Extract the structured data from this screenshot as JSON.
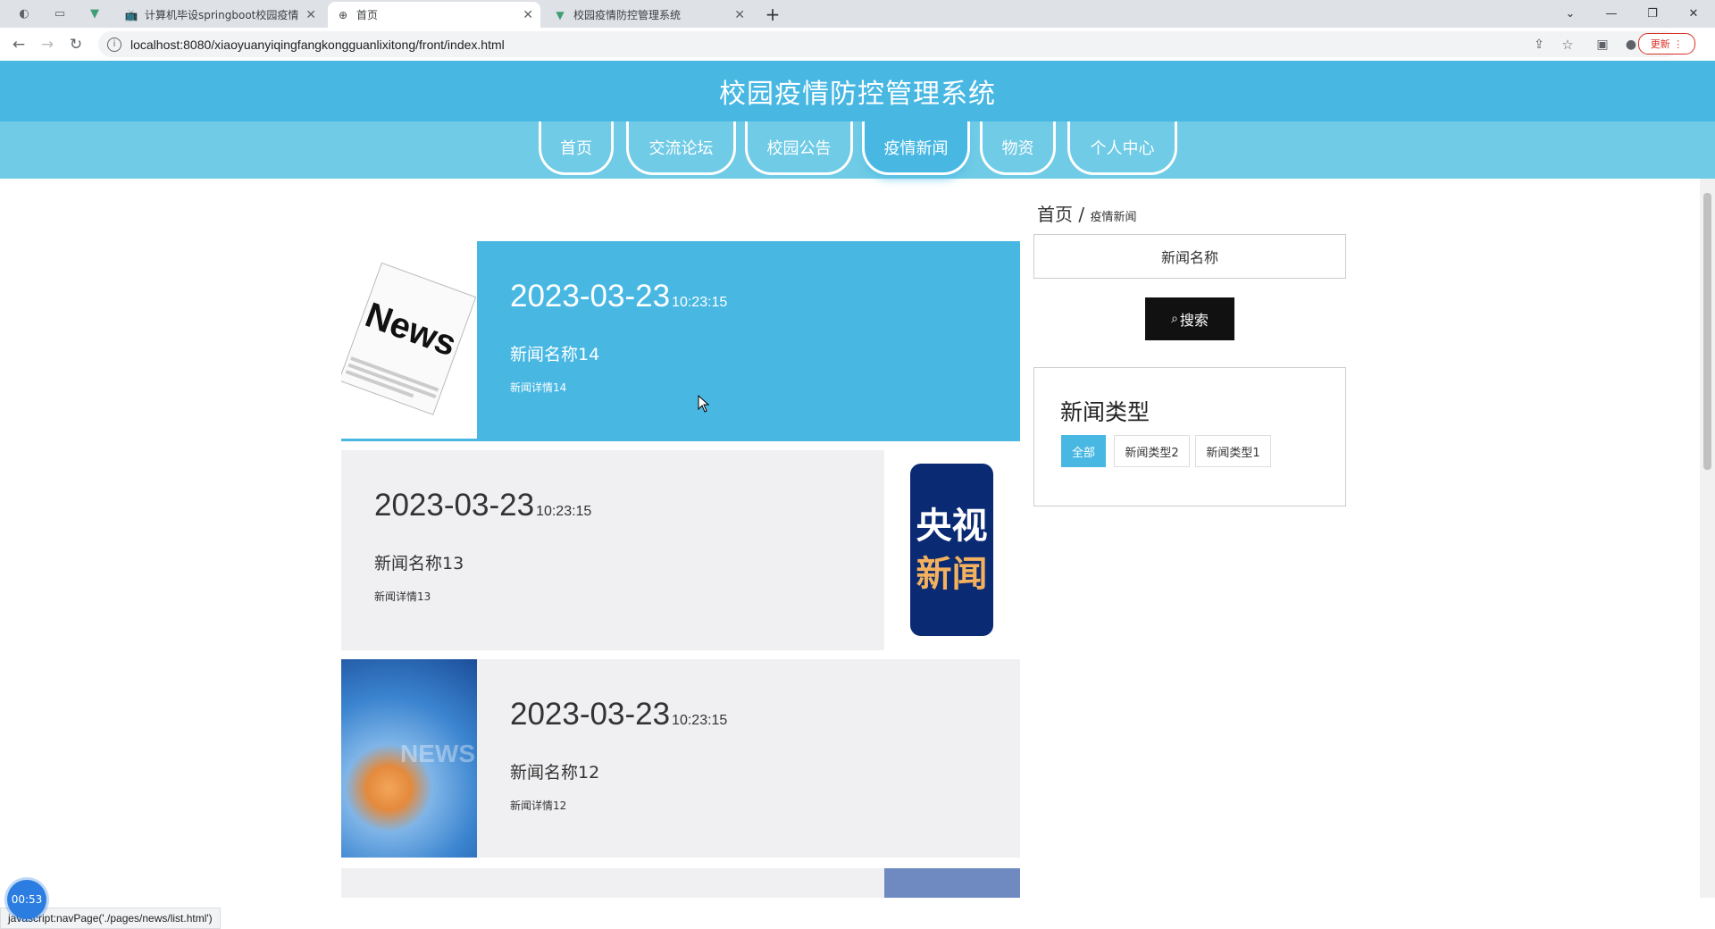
{
  "browser": {
    "tabs": [
      {
        "title": "计算机毕设springboot校园疫情",
        "icon": "bilibili-icon"
      },
      {
        "title": "首页",
        "icon": "globe-icon"
      },
      {
        "title": "校园疫情防控管理系统",
        "icon": "vue-icon"
      }
    ],
    "new_tab": "+",
    "url": "localhost:8080/xiaoyuanyiqingfangkongguanlixitong/front/index.html",
    "update_label": "更新",
    "status_text": "javascript:navPage('./pages/news/list.html')",
    "timer": "00:53"
  },
  "site": {
    "title": "校园疫情防控管理系统",
    "nav": [
      "首页",
      "交流论坛",
      "校园公告",
      "疫情新闻",
      "物资",
      "个人中心"
    ],
    "active_nav": "疫情新闻",
    "accent_color": "#48b8e3"
  },
  "breadcrumb": {
    "home": "首页",
    "separator": "/",
    "current": "疫情新闻"
  },
  "search": {
    "placeholder": "新闻名称",
    "button_label": "搜索"
  },
  "news_types": {
    "title": "新闻类型",
    "items": [
      "全部",
      "新闻类型2",
      "新闻类型1"
    ],
    "active": "全部"
  },
  "news": [
    {
      "date": "2023-03-23",
      "time": "10:23:15",
      "name": "新闻名称14",
      "detail": "新闻详情14",
      "image": "news-paper-image"
    },
    {
      "date": "2023-03-23",
      "time": "10:23:15",
      "name": "新闻名称13",
      "detail": "新闻详情13",
      "image": "cctv-news-logo",
      "logo_text": [
        "央视",
        "新闻"
      ]
    },
    {
      "date": "2023-03-23",
      "time": "10:23:15",
      "name": "新闻名称12",
      "detail": "新闻详情12",
      "image": "globe-news-image",
      "logo_text": "NEWS"
    }
  ]
}
